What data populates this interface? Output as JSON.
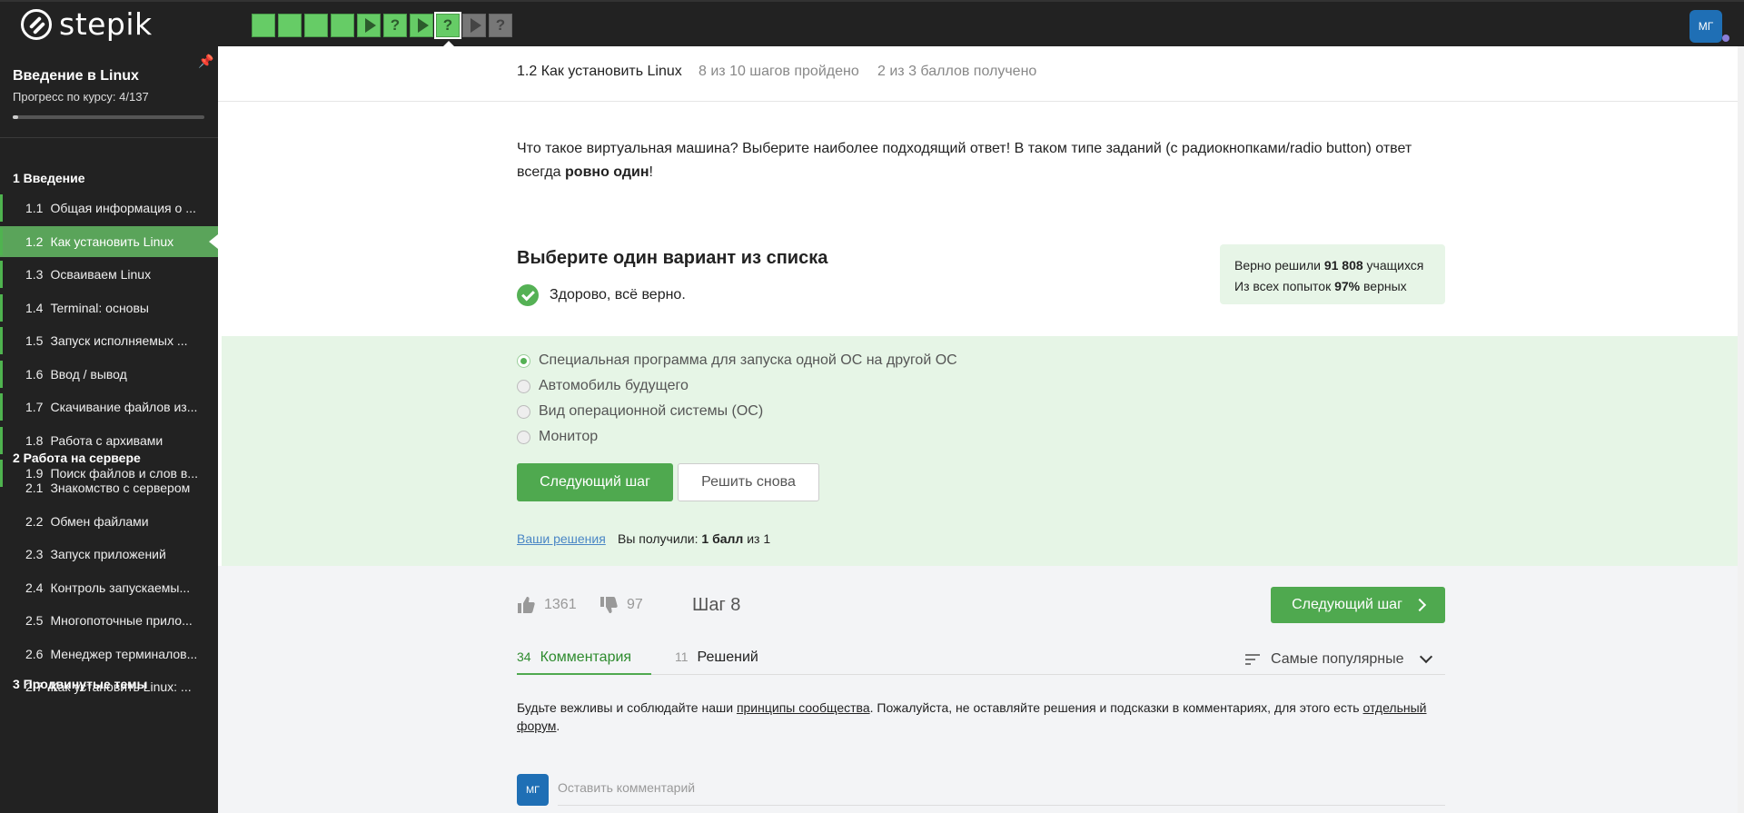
{
  "brand": {
    "name": "stepik"
  },
  "topbar": {
    "steps": [
      {
        "kind": "blank",
        "state": "done"
      },
      {
        "kind": "blank",
        "state": "done"
      },
      {
        "kind": "blank",
        "state": "done"
      },
      {
        "kind": "blank",
        "state": "done"
      },
      {
        "kind": "play",
        "state": "done"
      },
      {
        "kind": "question",
        "state": "done"
      },
      {
        "kind": "play",
        "state": "done"
      },
      {
        "kind": "question",
        "state": "active"
      },
      {
        "kind": "play",
        "state": "todo"
      },
      {
        "kind": "question",
        "state": "todo"
      }
    ],
    "avatar_initials": "МГ"
  },
  "sidebar": {
    "course_title": "Введение в Linux",
    "progress_label": "Прогресс по курсу:  4/137",
    "progress_fraction": 0.029,
    "sections": [
      {
        "title": "1  Введение",
        "lessons": [
          {
            "num": "1.1",
            "title": "Общая информация о ..."
          },
          {
            "num": "1.2",
            "title": "Как установить Linux",
            "active": true
          },
          {
            "num": "1.3",
            "title": "Осваиваем Linux"
          },
          {
            "num": "1.4",
            "title": "Terminal: основы"
          },
          {
            "num": "1.5",
            "title": "Запуск исполняемых ..."
          },
          {
            "num": "1.6",
            "title": "Ввод / вывод"
          },
          {
            "num": "1.7",
            "title": "Скачивание файлов из..."
          },
          {
            "num": "1.8",
            "title": "Работа с архивами"
          },
          {
            "num": "1.9",
            "title": "Поиск файлов и слов в..."
          }
        ]
      },
      {
        "title": "2  Работа на сервере",
        "lessons": [
          {
            "num": "2.1",
            "title": "Знакомство с сервером"
          },
          {
            "num": "2.2",
            "title": "Обмен файлами"
          },
          {
            "num": "2.3",
            "title": "Запуск приложений"
          },
          {
            "num": "2.4",
            "title": "Контроль запускаемы..."
          },
          {
            "num": "2.5",
            "title": "Многопоточные прило..."
          },
          {
            "num": "2.6",
            "title": "Менеджер терминалов..."
          },
          {
            "num": "2.7",
            "title": "Как установить Linux: ..."
          }
        ]
      },
      {
        "title": "3  Продвинутые темы",
        "lessons": []
      }
    ]
  },
  "lesson_header": {
    "title": "1.2 Как установить Linux",
    "steps_done": "8 из 10 шагов пройдено",
    "score": "2 из 3 баллов  получено"
  },
  "question": {
    "text_before": "Что такое виртуальная машина? Выберите наиболее подходящий ответ! В таком типе заданий (с радиокнопками/radio button) ответ всегда ",
    "text_bold": "ровно один",
    "text_after": "!",
    "heading": "Выберите один вариант из списка",
    "status": "Здорово, всё верно."
  },
  "stats": {
    "line1_prefix": "Верно решили ",
    "line1_value": "91 808",
    "line1_suffix": " учащихся",
    "line2_prefix": "Из всех попыток ",
    "line2_value": "97%",
    "line2_suffix": " верных"
  },
  "options": [
    {
      "label": "Специальная программа для запуска одной ОС на другой ОС",
      "checked": true
    },
    {
      "label": "Автомобиль будущего",
      "checked": false
    },
    {
      "label": "Вид операционной системы (ОС)",
      "checked": false
    },
    {
      "label": "Монитор",
      "checked": false
    }
  ],
  "actions": {
    "next_step": "Следующий шаг",
    "solve_again": "Решить снова",
    "your_solutions": "Ваши решения",
    "you_got_prefix": "Вы получили: ",
    "you_got_bold": "1 балл",
    "you_got_suffix": " из 1"
  },
  "feedback": {
    "likes": "1361",
    "dislikes": "97",
    "step_label": "Шаг 8",
    "next_step": "Следующий шаг"
  },
  "discussion": {
    "tabs": [
      {
        "count": "34",
        "label": "Комментария",
        "active": true
      },
      {
        "count": "11",
        "label": "Решений",
        "active": false
      }
    ],
    "sort_label": "Самые популярные",
    "guidelines_1": "Будьте вежливы и соблюдайте наши ",
    "guidelines_link1": "принципы сообщества",
    "guidelines_2": ". Пожалуйста, не оставляйте решения и подсказки в комментариях, для этого есть ",
    "guidelines_link2": "отдельный форум",
    "guidelines_3": ".",
    "avatar_initials": "МГ",
    "comment_placeholder": "Оставить комментарий"
  },
  "colors": {
    "topbar_bg": "#222222",
    "accent_green": "#4fa94f",
    "answer_bg": "#e6f5e6",
    "link_blue": "#4a86c5",
    "avatar_blue": "#1f6fb5"
  }
}
